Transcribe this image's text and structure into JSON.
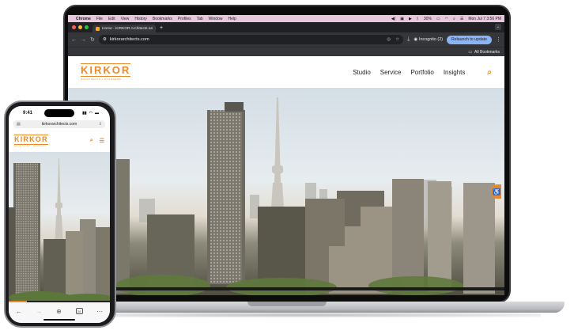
{
  "menubar": {
    "app": "Chrome",
    "items": [
      "File",
      "Edit",
      "View",
      "History",
      "Bookmarks",
      "Profiles",
      "Tab",
      "Window",
      "Help"
    ],
    "battery": "30%",
    "clock": "Mon Jul 7  3:56 PM"
  },
  "browser": {
    "tab_title": "Home - KIRKOR Architects an",
    "url": "kirkorarchitects.com",
    "incognito_label": "Incognito (2)",
    "relaunch_label": "Relaunch to update",
    "bookmarks_label": "All Bookmarks"
  },
  "site": {
    "logo_text": "KIRKOR",
    "logo_sub": "ARCHITECTS + PLANNERS",
    "nav": [
      "Studio",
      "Service",
      "Portfolio",
      "Insights"
    ],
    "slider_progress": 0.09
  },
  "phone": {
    "time": "9:41",
    "url": "kirkorarchitects.com",
    "tabs_count": "30",
    "slider_progress": 0.18
  },
  "colors": {
    "brand": "#e8892b",
    "menubar": "#e9c8de",
    "chrome_dark": "#35363a",
    "relaunch": "#8ab4f8"
  },
  "icons": [
    "apple-icon",
    "search-icon",
    "hamburger-icon",
    "accessibility-icon",
    "star-icon",
    "download-icon",
    "lock-icon",
    "share-icon",
    "back-icon",
    "forward-icon",
    "add-icon",
    "more-icon"
  ]
}
